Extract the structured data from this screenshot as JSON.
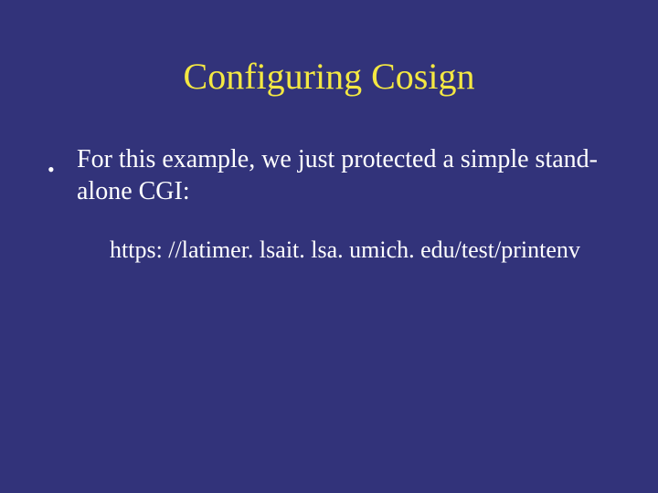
{
  "slide": {
    "title": "Configuring Cosign",
    "bullet1": "For this example, we just protected a simple stand-alone CGI:",
    "url": "https: //latimer. lsait. lsa. umich. edu/test/printenv"
  }
}
